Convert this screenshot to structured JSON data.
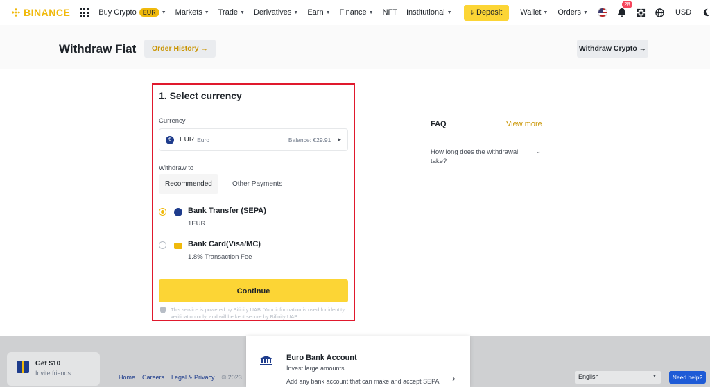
{
  "nav": {
    "logo_text": "BINANCE",
    "items": [
      {
        "label": "Buy Crypto",
        "badge": "EUR",
        "caret": true
      },
      {
        "label": "Markets",
        "caret": true
      },
      {
        "label": "Trade",
        "caret": true
      },
      {
        "label": "Derivatives",
        "caret": true
      },
      {
        "label": "Earn",
        "caret": true
      },
      {
        "label": "Finance",
        "caret": true
      },
      {
        "label": "NFT",
        "caret": false
      },
      {
        "label": "Institutional",
        "caret": true
      }
    ],
    "deposit_label": "Deposit",
    "wallet_label": "Wallet",
    "orders_label": "Orders",
    "notification_count": "28",
    "currency_label": "USD"
  },
  "page": {
    "title": "Withdraw Fiat",
    "order_history_label": "Order History →",
    "withdraw_crypto_label": "Withdraw Crypto →"
  },
  "form": {
    "heading": "1. Select currency",
    "currency_label": "Currency",
    "currency_code": "EUR",
    "currency_name": "Euro",
    "balance": "Balance: €29.91",
    "withdraw_to_label": "Withdraw to",
    "tabs": [
      "Recommended",
      "Other Payments"
    ],
    "options": [
      {
        "title": "Bank Transfer (SEPA)",
        "sub": "1EUR",
        "selected": true
      },
      {
        "title": "Bank Card(Visa/MC)",
        "sub": "1.8% Transaction Fee",
        "selected": false
      }
    ],
    "continue_label": "Continue",
    "note": "This service is powered by Bifinity UAB. Your information is used for identity verification only, and will be kept secure by Bifinity UAB."
  },
  "faq": {
    "title": "FAQ",
    "view_more": "View more",
    "question": "How long does the withdrawal take?"
  },
  "footer": {
    "gift_title": "Get $10",
    "gift_sub": "Invite friends",
    "links": [
      "Home",
      "Careers",
      "Legal & Privacy"
    ],
    "copyright": "© 2023",
    "language": "English",
    "help_label": "Need help?"
  },
  "popup": {
    "title": "Euro Bank Account",
    "subtitle": "Invest large amounts",
    "description": "Add any bank account that can make and accept SEPA"
  },
  "colors": {
    "brand_yellow": "#fcd535",
    "brand_gold": "#f0b90b",
    "link_gold": "#c99400",
    "highlight_red": "#e0192d"
  }
}
